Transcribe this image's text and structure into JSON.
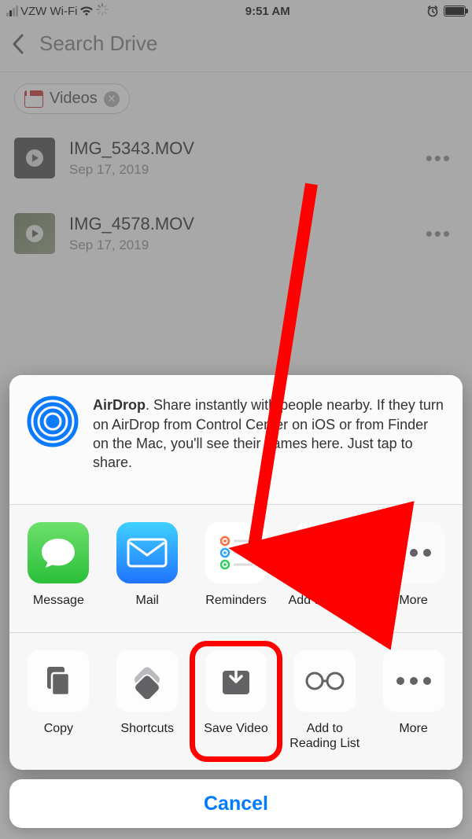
{
  "status": {
    "carrier": "VZW Wi-Fi",
    "time": "9:51 AM"
  },
  "search": {
    "placeholder": "Search Drive"
  },
  "filter_chip": {
    "label": "Videos"
  },
  "files": [
    {
      "name": "IMG_5343.MOV",
      "date": "Sep 17, 2019"
    },
    {
      "name": "IMG_4578.MOV",
      "date": "Sep 17, 2019"
    }
  ],
  "airdrop": {
    "title": "AirDrop",
    "body": ". Share instantly with people nearby. If they turn on AirDrop from Control Center on iOS or from Finder on the Mac, you'll see their names here. Just tap to share."
  },
  "share_apps": [
    {
      "key": "message",
      "label": "Message"
    },
    {
      "key": "mail",
      "label": "Mail"
    },
    {
      "key": "reminders",
      "label": "Reminders"
    },
    {
      "key": "notes",
      "label": "Add to Notes"
    },
    {
      "key": "more",
      "label": "More"
    }
  ],
  "actions": [
    {
      "key": "copy",
      "label": "Copy"
    },
    {
      "key": "shortcuts",
      "label": "Shortcuts"
    },
    {
      "key": "savevideo",
      "label": "Save Video"
    },
    {
      "key": "readinglist",
      "label": "Add to Reading List"
    },
    {
      "key": "more",
      "label": "More"
    }
  ],
  "cancel_label": "Cancel",
  "highlight_action_key": "savevideo"
}
